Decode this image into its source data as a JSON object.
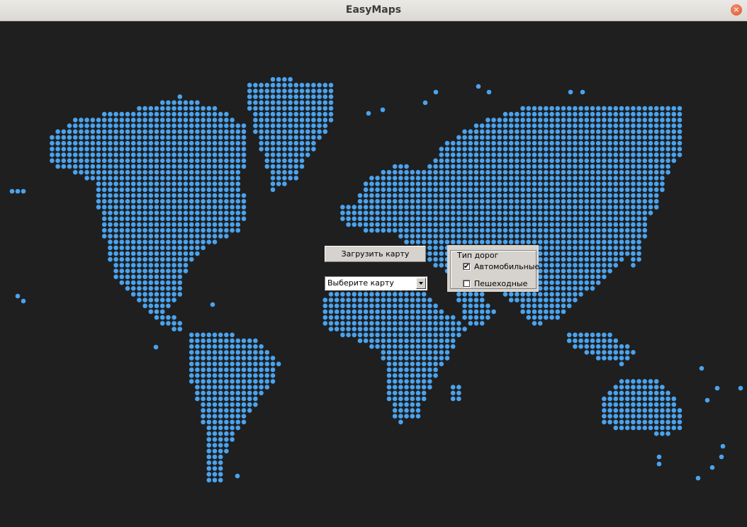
{
  "window": {
    "title": "EasyMaps",
    "close_glyph": "×"
  },
  "colors": {
    "background": "#1f1f1f",
    "dot": "#4aa3ee"
  },
  "icons": {
    "close": "close-icon",
    "checkbox_checked": "checkmark-icon",
    "dropdown": "chevron-down-icon"
  },
  "controls": {
    "load_button": "Загрузить карту",
    "map_select": {
      "selected": "Выберите карту"
    },
    "road_type": {
      "legend": "Тип дорог",
      "options": [
        {
          "label": "Автомобильные",
          "checked": true,
          "mark": "✔"
        },
        {
          "label": "Пешеходные",
          "checked": false,
          "mark": ""
        }
      ]
    }
  }
}
